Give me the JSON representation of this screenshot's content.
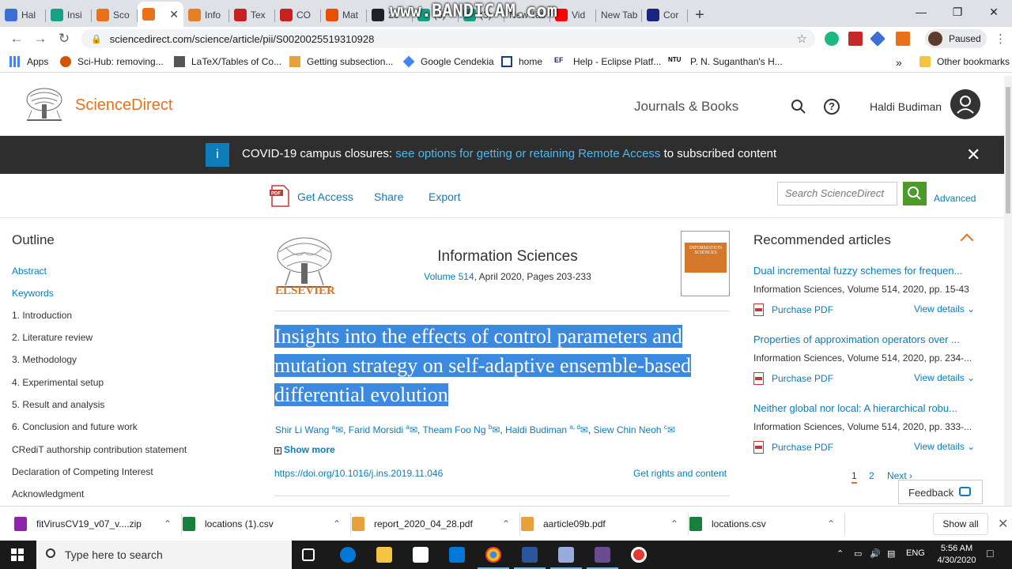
{
  "browser": {
    "tabs": [
      {
        "label": "Hal",
        "favicon_color": "#3c6fd6"
      },
      {
        "label": "Insi",
        "favicon_color": "#16a085"
      },
      {
        "label": "Sco",
        "favicon_color": "#e9711c"
      },
      {
        "label": "",
        "favicon_color": "#e9711c",
        "active": true
      },
      {
        "label": "Info",
        "favicon_color": "#e67e22"
      },
      {
        "label": "Tex",
        "favicon_color": "#c5221f"
      },
      {
        "label": "CO",
        "favicon_color": "#c5221f"
      },
      {
        "label": "Mat",
        "favicon_color": "#e65100"
      },
      {
        "label": "20",
        "favicon_color": "#202124"
      },
      {
        "label": "(3)",
        "favicon_color": "#16a085"
      },
      {
        "label": "(3)",
        "favicon_color": "#16a085"
      },
      {
        "label": "New Tab",
        "favicon_color": ""
      },
      {
        "label": "Vid",
        "favicon_color": "#ff0000"
      },
      {
        "label": "New Tab",
        "favicon_color": ""
      },
      {
        "label": "Cor",
        "favicon_color": "#1a237e"
      }
    ],
    "watermark": "www.BANDICAM.com",
    "url": "sciencedirect.com/science/article/pii/S0020025519310928",
    "profile_status": "Paused",
    "bookmarks": [
      {
        "label": "Apps"
      },
      {
        "label": "Sci-Hub: removing..."
      },
      {
        "label": "LaTeX/Tables of Co..."
      },
      {
        "label": "Getting subsection..."
      },
      {
        "label": "Google Cendekia"
      },
      {
        "label": "home"
      },
      {
        "label": "Help - Eclipse Platf..."
      },
      {
        "label": "P. N. Suganthan's H..."
      }
    ],
    "other_bookmarks": "Other bookmarks",
    "more_bookmarks": "»"
  },
  "header": {
    "brand": "ScienceDirect",
    "journals_books": "Journals & Books",
    "user_name": "Haldi Budiman",
    "help_glyph": "?"
  },
  "banner": {
    "icon_glyph": "i",
    "prefix": "COVID-19 campus closures: ",
    "link": "see options for getting or retaining Remote Access",
    "suffix": " to subscribed content",
    "close_glyph": "✕"
  },
  "article_toolbar": {
    "get_access": "Get Access",
    "share": "Share",
    "export": "Export",
    "search_placeholder": "Search ScienceDirect",
    "advanced": "Advanced"
  },
  "outline": {
    "title": "Outline",
    "items": [
      {
        "label": "Abstract",
        "link": true
      },
      {
        "label": "Keywords",
        "link": true
      },
      {
        "label": "1. Introduction"
      },
      {
        "label": "2. Literature review"
      },
      {
        "label": "3. Methodology"
      },
      {
        "label": "4. Experimental setup"
      },
      {
        "label": "5. Result and analysis"
      },
      {
        "label": "6. Conclusion and future work"
      },
      {
        "label": "CRediT authorship contribution statement"
      },
      {
        "label": "Declaration of Competing Interest"
      },
      {
        "label": "Acknowledgment"
      }
    ]
  },
  "article": {
    "publisher": "ELSEVIER",
    "journal": "Information Sciences",
    "volume": "Volume 514",
    "issue_info": ", April 2020, Pages 203-233",
    "cover_text": "INFORMATION SCIENCES",
    "title": "Insights into the effects of control parameters and mutation strategy on self-adaptive ensemble-based differential evolution",
    "authors": [
      {
        "name": "Shir Li Wang",
        "sup": "a"
      },
      {
        "name": "Farid Morsidi",
        "sup": "a"
      },
      {
        "name": "Theam Foo Ng",
        "sup": "b"
      },
      {
        "name": "Haldi Budiman",
        "sup": "a, d"
      },
      {
        "name": "Siew Chin Neoh",
        "sup": "c"
      }
    ],
    "show_more": "Show more",
    "doi": "https://doi.org/10.1016/j.ins.2019.11.046",
    "rights": "Get rights and content"
  },
  "recommended": {
    "title": "Recommended articles",
    "items": [
      {
        "title": "Dual incremental fuzzy schemes for frequen...",
        "source": "Information Sciences, Volume 514, 2020, pp. 15-43",
        "pdf": "Purchase PDF",
        "view": "View details"
      },
      {
        "title": "Properties of approximation operators over ...",
        "source": "Information Sciences, Volume 514, 2020, pp. 234-...",
        "pdf": "Purchase PDF",
        "view": "View details"
      },
      {
        "title": "Neither global nor local: A hierarchical robu...",
        "source": "Information Sciences, Volume 514, 2020, pp. 333-...",
        "pdf": "Purchase PDF",
        "view": "View details"
      }
    ],
    "pages": [
      "1",
      "2"
    ],
    "next": "Next",
    "feedback": "Feedback"
  },
  "downloads": {
    "items": [
      {
        "name": "fitVirusCV19_v07_v....zip",
        "color": "#8e24aa"
      },
      {
        "name": "locations (1).csv",
        "color": "#188038"
      },
      {
        "name": "report_2020_04_28.pdf",
        "color": "#e9a23b"
      },
      {
        "name": "aarticle09b.pdf",
        "color": "#e9a23b"
      },
      {
        "name": "locations.csv",
        "color": "#188038"
      }
    ],
    "show_all": "Show all"
  },
  "taskbar": {
    "search_placeholder": "Type here to search",
    "language": "ENG",
    "time": "5:56 AM",
    "date": "4/30/2020"
  }
}
